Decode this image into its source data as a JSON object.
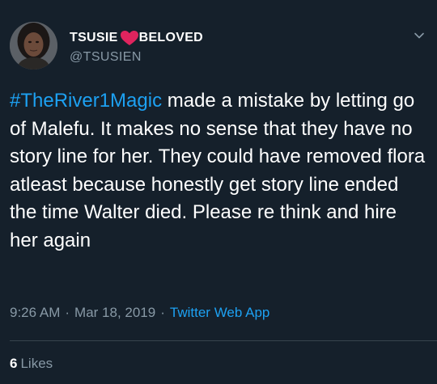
{
  "tweet": {
    "author": {
      "name_part1": "TSUSIE",
      "name_emoji": "red-heart",
      "name_part2": "BELOVED",
      "handle": "@TSUSIEN"
    },
    "hashtag": "#TheRiver1Magic",
    "text": " made a mistake by letting go of Malefu. It makes no sense that they have no story line for her. They could have removed flora atleast because honestly get story line ended the time Walter died. Please re think and hire her again",
    "time": "9:26 AM",
    "separator": "·",
    "date": "Mar 18, 2019",
    "app": "Twitter Web App",
    "likes_count": "6",
    "likes_label": "Likes"
  },
  "colors": {
    "background": "#15202b",
    "link": "#1da1f2",
    "secondary_text": "#8899a6",
    "heart": "#e0245e"
  },
  "icons": {
    "menu": "chevron-down-icon",
    "name_emoji": "heart-icon"
  }
}
